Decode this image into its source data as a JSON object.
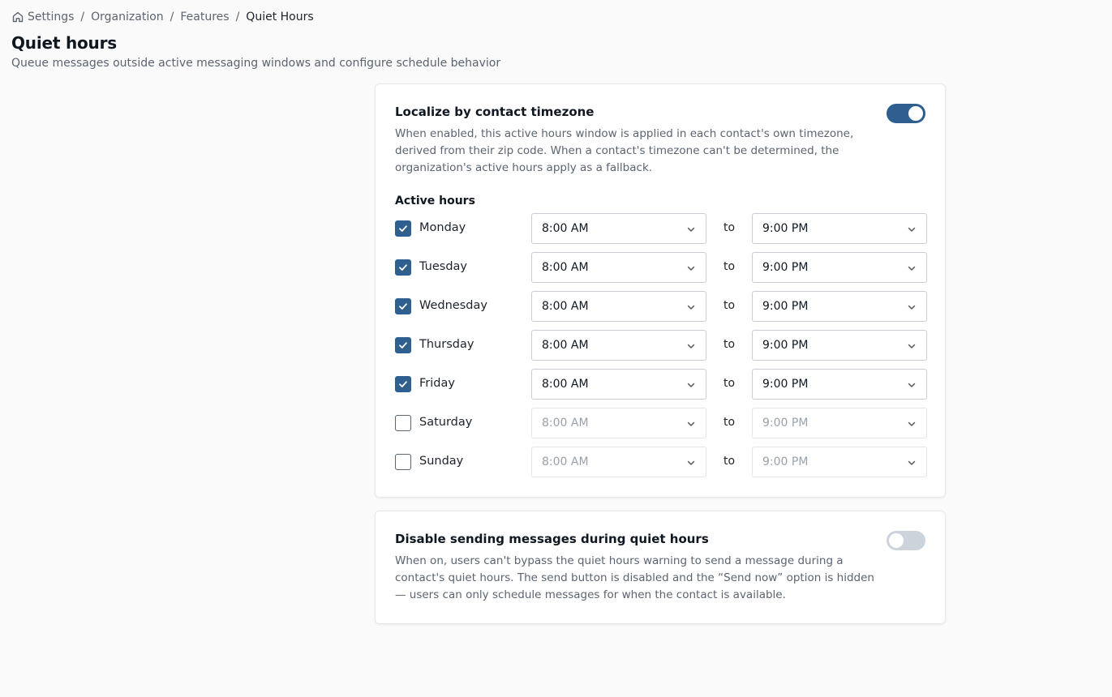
{
  "breadcrumb": {
    "items": [
      "Settings",
      "Organization",
      "Features"
    ],
    "current": "Quiet Hours",
    "separator": "/"
  },
  "page": {
    "title": "Quiet hours",
    "subtitle": "Queue messages outside active messaging windows and configure schedule behavior"
  },
  "localize": {
    "title": "Localize by contact timezone",
    "description": "When enabled, this active hours window is applied in each contact's own timezone, derived from their zip code. When a contact's timezone can't be determined, the organization's active hours apply as a fallback.",
    "enabled": true
  },
  "active_hours": {
    "label": "Active hours",
    "connector": "to",
    "days": [
      {
        "day": "Monday",
        "checked": true,
        "start": "8:00 AM",
        "end": "9:00 PM"
      },
      {
        "day": "Tuesday",
        "checked": true,
        "start": "8:00 AM",
        "end": "9:00 PM"
      },
      {
        "day": "Wednesday",
        "checked": true,
        "start": "8:00 AM",
        "end": "9:00 PM"
      },
      {
        "day": "Thursday",
        "checked": true,
        "start": "8:00 AM",
        "end": "9:00 PM"
      },
      {
        "day": "Friday",
        "checked": true,
        "start": "8:00 AM",
        "end": "9:00 PM"
      },
      {
        "day": "Saturday",
        "checked": false,
        "start": "8:00 AM",
        "end": "9:00 PM"
      },
      {
        "day": "Sunday",
        "checked": false,
        "start": "8:00 AM",
        "end": "9:00 PM"
      }
    ]
  },
  "disable_sending": {
    "title": "Disable sending messages during quiet hours",
    "description": "When on, users can't bypass the quiet hours warning to send a message during a contact's quiet hours. The send button is disabled and the “Send now” option is hidden — users can only schedule messages for when the contact is available.",
    "enabled": false
  },
  "colors": {
    "accent": "#2e5f8f",
    "toggle_off": "#cdd3da",
    "muted_text": "#5b6470",
    "page_bg": "#fafafa"
  },
  "icons": {
    "home": "home-icon",
    "checkmark": "check-icon",
    "select_arrow": "chevron-down-icon"
  }
}
